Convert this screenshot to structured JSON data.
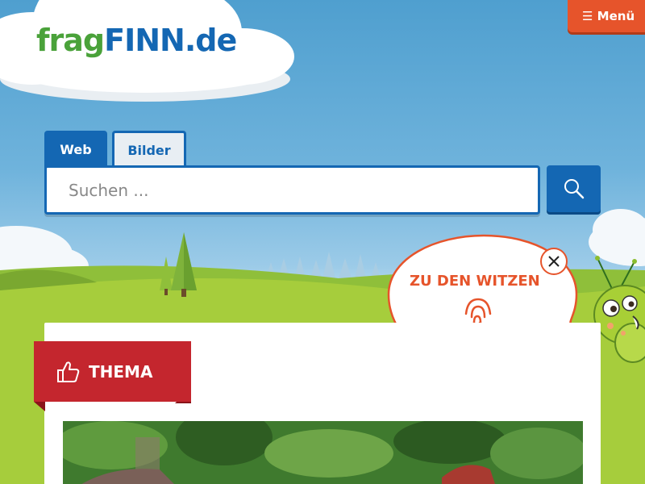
{
  "logo": {
    "part1": "frag",
    "part2": "FINN",
    "part3": ".de"
  },
  "menu": {
    "label": "☰ Menü"
  },
  "search": {
    "tabs": [
      {
        "label": "Web"
      },
      {
        "label": "Bilder"
      }
    ],
    "placeholder": "Suchen ..."
  },
  "promo": {
    "label": "ZU DEN WITZEN"
  },
  "content": {
    "badge_label": "THEMA"
  },
  "colors": {
    "brand_blue": "#1467b3",
    "brand_green": "#4aa23a",
    "accent_orange": "#e6542b",
    "badge_red": "#c4262e"
  }
}
